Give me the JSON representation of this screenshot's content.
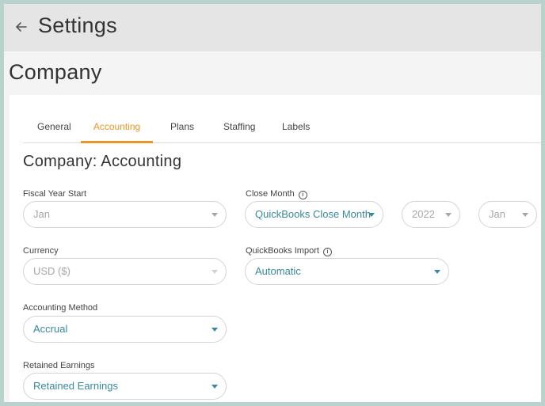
{
  "header": {
    "title": "Settings",
    "back_icon": "arrow-left-icon"
  },
  "page": {
    "title": "Company"
  },
  "tabs": [
    {
      "label": "General",
      "active": false
    },
    {
      "label": "Accounting",
      "active": true
    },
    {
      "label": "Plans",
      "active": false
    },
    {
      "label": "Staffing",
      "active": false
    },
    {
      "label": "Labels",
      "active": false
    }
  ],
  "section": {
    "title": "Company: Accounting"
  },
  "form": {
    "fiscal_year_start": {
      "label": "Fiscal Year Start",
      "value": "Jan"
    },
    "close_month": {
      "label": "Close Month",
      "info_icon": "i",
      "source_value": "QuickBooks Close Month",
      "year_value": "2022",
      "month_value": "Jan"
    },
    "currency": {
      "label": "Currency",
      "value": "USD ($)"
    },
    "quickbooks_import": {
      "label": "QuickBooks Import",
      "info_icon": "i",
      "value": "Automatic"
    },
    "accounting_method": {
      "label": "Accounting Method",
      "value": "Accrual"
    },
    "retained_earnings": {
      "label": "Retained Earnings",
      "value": "Retained Earnings"
    }
  },
  "colors": {
    "accent": "#e8962a",
    "link": "#3a8a9a",
    "border": "#b9d3cc"
  }
}
